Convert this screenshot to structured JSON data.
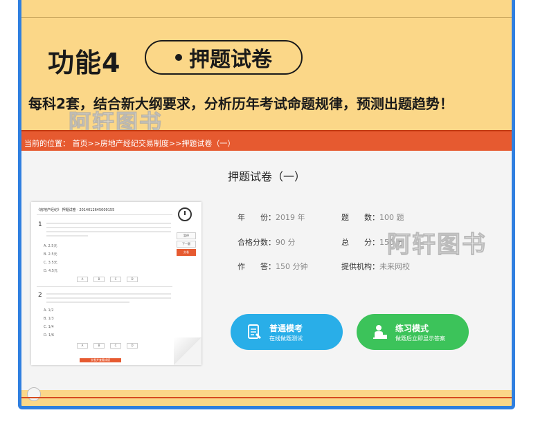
{
  "banner": {
    "feature_label": "功能4",
    "feature_name": "押题试卷",
    "subtitle": "每科2套，结合新大纲要求，分析历年考试命题规律，预测出题趋势！",
    "watermark": "阿轩图书"
  },
  "screen": {
    "breadcrumb": "当前的位置： 首页>>房地产经纪交易制度>>押题试卷（一）",
    "paper_title": "押题试卷（一）",
    "thumbnail": {
      "header": "《房地产经纪》 押题试卷 · 2014012645009155",
      "q1_num": "1",
      "q2_num": "2",
      "q1_opts": [
        "A. 2.5元",
        "B. 2.5元",
        "C. 3.5元",
        "D. 4.5元"
      ],
      "q2_opts": [
        "A. 1/2",
        "B. 1/3",
        "C. 1/4",
        "D. 1/6"
      ],
      "ans": [
        "A",
        "B",
        "C",
        "D"
      ],
      "side_btns": [
        "暂停",
        "下一题",
        "交卷"
      ],
      "submit": "交卷并查看成绩"
    },
    "info": {
      "year_label": "年　　份：",
      "year_value": "2019 年",
      "count_label": "题　　数：",
      "count_value": "100 题",
      "pass_label": "合格分数：",
      "pass_value": "90 分",
      "total_label": "总　　分：",
      "total_value": "150 分",
      "time_label": "作　　答：",
      "time_value": "150 分钟",
      "provider_label": "提供机构：",
      "provider_value": "未来网校"
    },
    "buttons": {
      "mock_title": "普通模考",
      "mock_sub": "在线做题测试",
      "practice_title": "练习模式",
      "practice_sub": "做题后立即显示答案"
    }
  },
  "colors": {
    "banner_bg": "#fbd788",
    "frame": "#2f7fe0",
    "header_bar": "#e65a30",
    "mock_button": "#29aee8",
    "practice_button": "#3cc35a"
  }
}
